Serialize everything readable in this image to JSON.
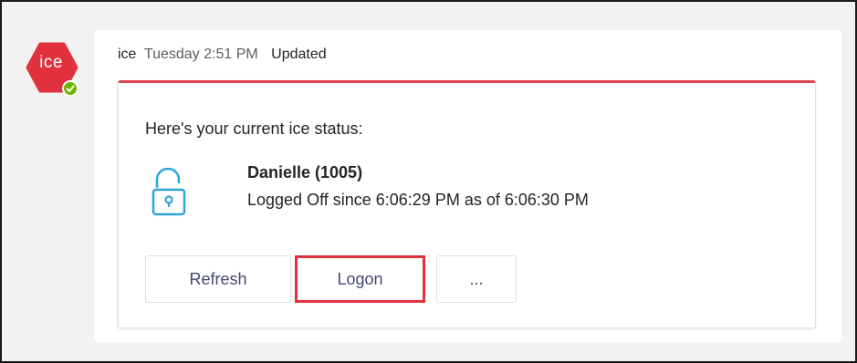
{
  "bot": {
    "avatar_text": "ice",
    "avatar_color": "#e0313d",
    "presence_status": "available",
    "presence_color": "#6bb700"
  },
  "message": {
    "sender": "ice",
    "timestamp": "Tuesday 2:51 PM",
    "edited_label": "Updated"
  },
  "card": {
    "accent_color": "#e0454f",
    "intro": "Here's your current ice status:",
    "status_icon": "lock-open-icon",
    "status_icon_color": "#2aa6dc",
    "user_name": "Danielle (1005)",
    "user_status": "Logged Off since 6:06:29 PM as of 6:06:30 PM",
    "actions": {
      "refresh_label": "Refresh",
      "logon_label": "Logon",
      "more_label": "..."
    },
    "highlight_color": "#e0313d"
  }
}
